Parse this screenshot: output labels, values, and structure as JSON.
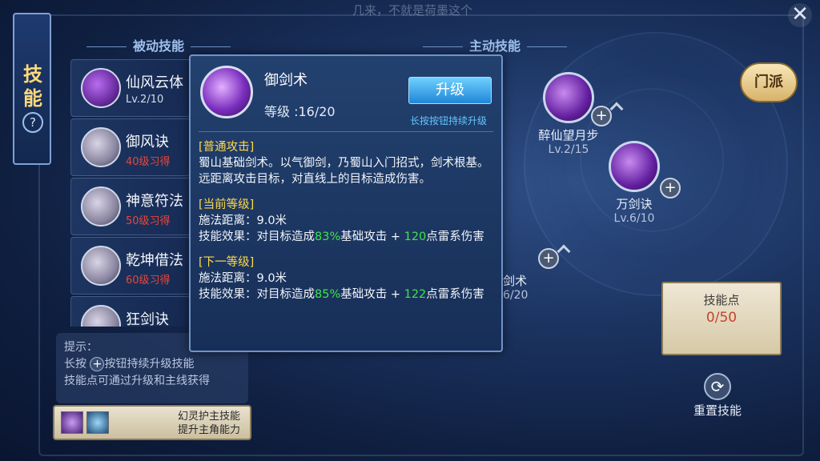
{
  "top_hint": "几来，不就是荷墨这个",
  "side_tab": {
    "label": "技能",
    "help": "?"
  },
  "close": "✕",
  "passive": {
    "title": "被动技能",
    "items": [
      {
        "name": "仙风云体",
        "sub": "Lv.2/10",
        "active": true
      },
      {
        "name": "御风诀",
        "sub": "40级习得",
        "active": false
      },
      {
        "name": "神意符法",
        "sub": "50级习得",
        "active": false
      },
      {
        "name": "乾坤借法",
        "sub": "60级习得",
        "active": false
      },
      {
        "name": "狂剑诀",
        "sub": "",
        "active": false
      }
    ]
  },
  "tips": {
    "title": "提示：",
    "line1_a": "长按",
    "line1_b": "按钮持续升级技能",
    "line2": "技能点可通过升级和主线获得"
  },
  "assist": {
    "line1": "幻灵护主技能",
    "line2": "提升主角能力"
  },
  "active": {
    "title": "主动技能",
    "skills": [
      {
        "name": "醉仙望月步",
        "lv": "Lv.2/15"
      },
      {
        "name": "万剑诀",
        "lv": "Lv.6/10"
      },
      {
        "name": "剑术",
        "lv": "6/20"
      }
    ]
  },
  "sect_button": "门派",
  "skill_points": {
    "label": "技能点",
    "value": "0/50"
  },
  "reset": {
    "label": "重置技能"
  },
  "popup": {
    "name": "御剑术",
    "level": "等级 :16/20",
    "upgrade": "升级",
    "hold_hint": "长按按钮持续升级",
    "normal_tag": "[普通攻击]",
    "desc": "蜀山基础剑术。以气御剑，乃蜀山入门招式，剑术根基。远距离攻击目标，对直线上的目标造成伤害。",
    "current_tag": "[当前等级]",
    "current_range": "施法距离：9.0米",
    "current_effect_a": "技能效果：对目标造成",
    "current_pct": "83%",
    "current_effect_b": "基础攻击 + ",
    "current_num": "120",
    "current_effect_c": "点雷系伤害",
    "next_tag": "[下一等级]",
    "next_range": "施法距离：9.0米",
    "next_effect_a": "技能效果：对目标造成",
    "next_pct": "85%",
    "next_effect_b": "基础攻击 + ",
    "next_num": "122",
    "next_effect_c": "点雷系伤害"
  }
}
